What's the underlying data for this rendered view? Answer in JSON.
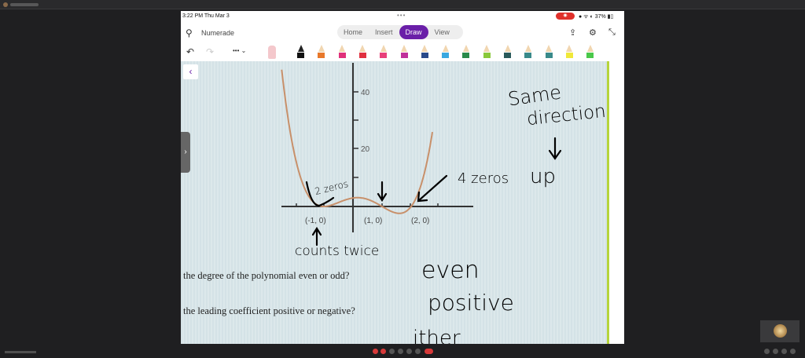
{
  "ipad": {
    "time": "3:22 PM   Thu Mar 3",
    "battery": "37%",
    "app_name": "Numerade",
    "tabs": [
      "Home",
      "Insert",
      "Draw",
      "View"
    ],
    "active_tab": "Draw"
  },
  "pens": [
    "#111111",
    "#e8782a",
    "#e0307a",
    "#e03040",
    "#e8407a",
    "#c0309a",
    "#2a4a8a",
    "#3aa8e0",
    "#2a8a4a",
    "#8ac83a",
    "#2a5a5a",
    "#3a8a8a",
    "#3a8a8a",
    "#f0e83a",
    "#4ac84a"
  ],
  "document": {
    "y_ticks": [
      "40",
      "20"
    ],
    "x_labels": [
      "(-1, 0)",
      "(1, 0)",
      "(2, 0)"
    ],
    "questions": [
      "the degree of the polynomial even or odd?",
      "the leading coefficient positive or negative?"
    ],
    "answers": [
      "even",
      "positive"
    ],
    "notes": {
      "two_zeros": "2 zeros",
      "four_zeros": "4 zeros",
      "counts_twice": "counts twice",
      "same": "Same",
      "direction": "direction",
      "up": "up",
      "partial": "ither"
    }
  },
  "colors": {
    "accent": "#6a1fa8",
    "curve": "#c8906a"
  }
}
